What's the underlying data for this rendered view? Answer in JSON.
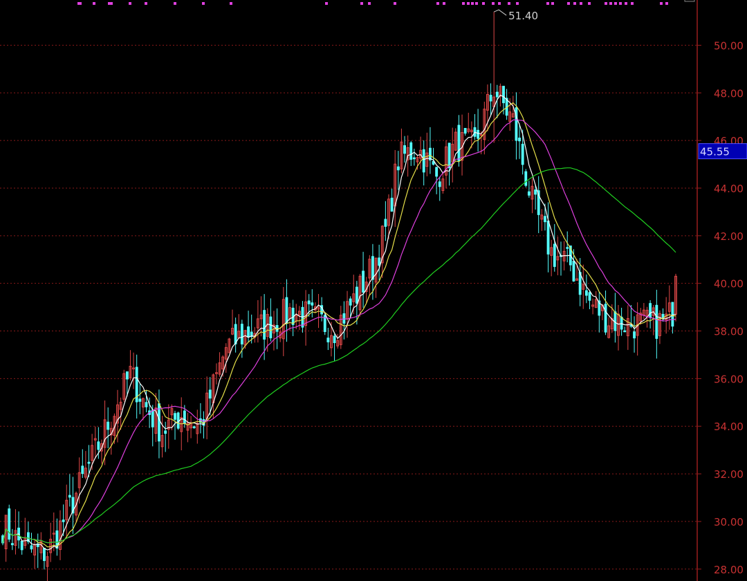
{
  "colors": {
    "background": "#000000",
    "grid": "#8a1a1a",
    "axis": "#9a1e1e",
    "tick_text": "#c83232",
    "up_candle": "#e04848",
    "down_candle": "#54ffff",
    "ma_short": "#ffffff",
    "ma_mid": "#e6e04a",
    "ma_long": "#e040e0",
    "ma_longest": "#20d020",
    "marker": "#e040e0",
    "current_bg": "#0000b4",
    "current_border": "#5050ff",
    "current_text": "#d8d8ff",
    "peak_text": "#d0d0d0"
  },
  "chart_data": {
    "type": "candlestick",
    "title": "",
    "xlabel": "",
    "ylabel": "",
    "ylim": [
      27.5,
      51.9
    ],
    "grid": true,
    "y_axis_side": "right",
    "yticks": [
      "28.00",
      "30.00",
      "32.00",
      "34.00",
      "36.00",
      "38.00",
      "40.00",
      "42.00",
      "44.00",
      "46.00",
      "48.00",
      "50.00"
    ],
    "peak_label": "51.40",
    "current_price": "45.55",
    "anchors": [
      [
        0,
        29.8
      ],
      [
        8,
        28.8
      ],
      [
        14,
        28.7
      ],
      [
        20,
        30.3
      ],
      [
        30,
        33.2
      ],
      [
        40,
        36.2
      ],
      [
        45,
        34.8
      ],
      [
        50,
        33.8
      ],
      [
        56,
        34.5
      ],
      [
        62,
        34.0
      ],
      [
        70,
        37.3
      ],
      [
        76,
        37.9
      ],
      [
        84,
        38.3
      ],
      [
        90,
        38.8
      ],
      [
        96,
        38.6
      ],
      [
        104,
        38.1
      ],
      [
        110,
        39.3
      ],
      [
        116,
        40.7
      ],
      [
        120,
        42.2
      ],
      [
        124,
        45.2
      ],
      [
        130,
        45.7
      ],
      [
        136,
        44.5
      ],
      [
        142,
        45.8
      ],
      [
        148,
        45.8
      ],
      [
        154,
        48.2
      ],
      [
        160,
        46.8
      ],
      [
        166,
        43.4
      ],
      [
        172,
        41.3
      ],
      [
        178,
        40.8
      ],
      [
        184,
        39.2
      ],
      [
        190,
        38.5
      ],
      [
        196,
        38.3
      ],
      [
        202,
        38.3
      ],
      [
        208,
        38.4
      ],
      [
        212,
        39.3
      ]
    ],
    "n_candles": 212,
    "ma_periods": [
      5,
      10,
      20,
      60
    ],
    "tail": {
      "ma5": [
        38.5,
        38.7,
        38.9,
        39.3
      ],
      "ma10": [
        38.3,
        38.4,
        38.6,
        38.8
      ],
      "ma20": [
        39.9,
        39.6,
        39.4,
        39.1
      ],
      "ma60": [
        42.9
      ]
    }
  }
}
